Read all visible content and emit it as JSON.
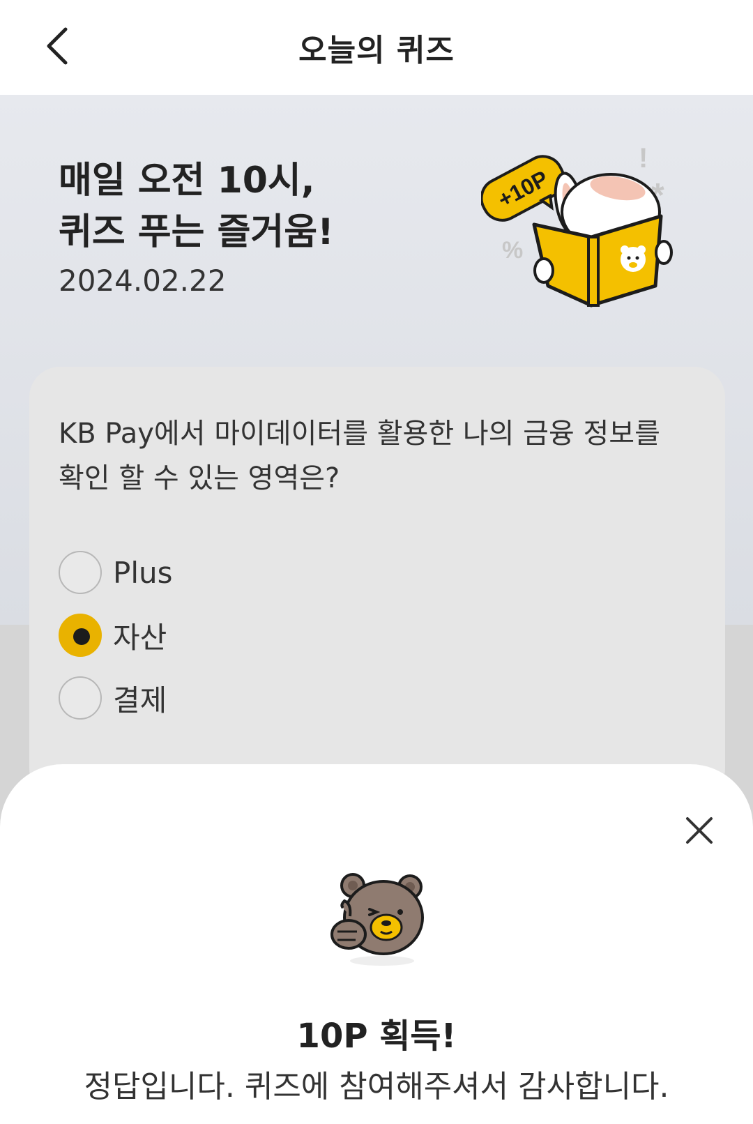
{
  "header": {
    "title": "오늘의 퀴즈"
  },
  "hero": {
    "title": "매일 오전 10시,\n퀴즈 푸는 즐거움!",
    "date": "2024.02.22",
    "badge": "+10P"
  },
  "quiz": {
    "question": "KB Pay에서 마이데이터를 활용한 나의 금융 정보를 확인 할 수 있는 영역은?",
    "options": [
      {
        "label": "Plus",
        "selected": false
      },
      {
        "label": "자산",
        "selected": true
      },
      {
        "label": "결제",
        "selected": false
      }
    ]
  },
  "result": {
    "title": "10P 획득!",
    "message": "정답입니다. 퀴즈에 참여해주셔서 감사합니다."
  },
  "colors": {
    "accent": "#e9b200",
    "card": "#e6e6e6"
  }
}
